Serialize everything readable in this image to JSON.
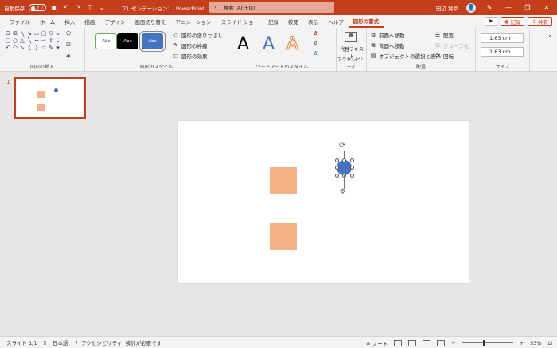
{
  "titlebar": {
    "autosave_label": "自動保存",
    "autosave_state": "オフ",
    "doc_title": "プレゼンテーション1 - PowerPoint",
    "search_placeholder": "検索 (Alt+Q)",
    "user_name": "田辺 賢幸",
    "avatar_glyph": "👤"
  },
  "tabs": [
    "ファイル",
    "ホーム",
    "挿入",
    "描画",
    "デザイン",
    "画面切り替え",
    "アニメーション",
    "スライド ショー",
    "記録",
    "校閲",
    "表示",
    "ヘルプ",
    "図形の書式"
  ],
  "active_tab": "図形の書式",
  "tab_actions": {
    "record": "記録",
    "share": "共有"
  },
  "ribbon": {
    "insert_shapes_label": "図形の挿入",
    "shape_styles_label": "図形のスタイル",
    "style_sample": "Abc",
    "fill": "図形の塗りつぶし",
    "outline": "図形の枠線",
    "effects": "図形の効果",
    "wordart_label": "ワードアートのスタイル",
    "wordart_letter": "A",
    "accessibility_label": "アクセシビリティ",
    "alt_text": "代替テキスト",
    "arrange_label": "配置",
    "bring_forward": "前面へ移動",
    "send_backward": "背面へ移動",
    "selection_pane": "オブジェクトの選択と表示",
    "align": "配置",
    "group": "グループ化",
    "rotate": "回転",
    "size_label": "サイズ",
    "height": "1.63 cm",
    "width": "1.63 cm"
  },
  "thumbnails": {
    "slide_number": "1"
  },
  "statusbar": {
    "slide_info": "スライド 1/1",
    "language": "日本語",
    "accessibility": "アクセシビリティ: 検討が必要です",
    "notes": "ノート",
    "zoom": "53%"
  },
  "colors": {
    "accent": "#c43e1c",
    "square_fill": "#f4b183",
    "circle_fill": "#4472c4"
  }
}
